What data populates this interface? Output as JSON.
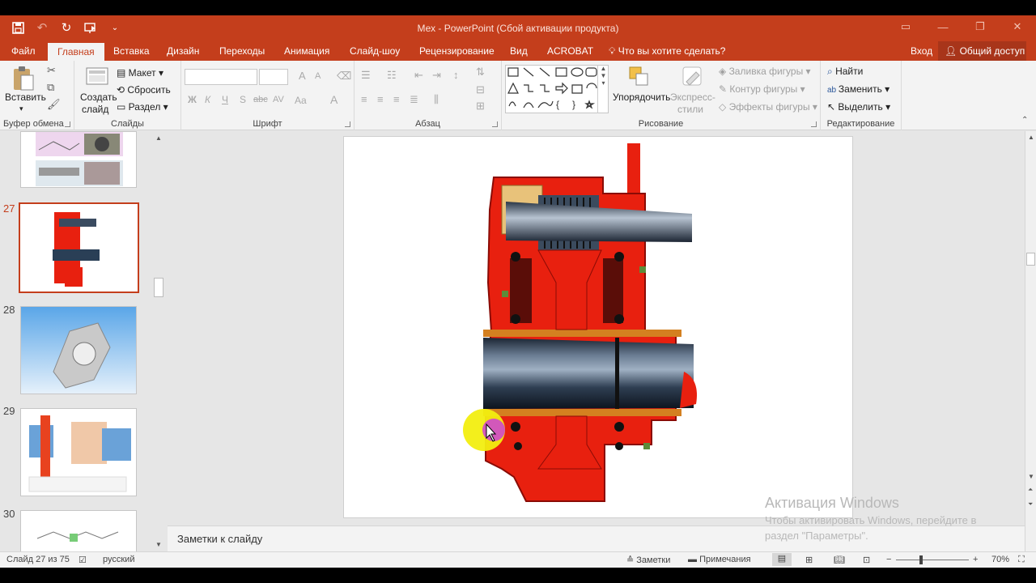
{
  "window": {
    "title": "Мех - PowerPoint (Сбой активации продукта)"
  },
  "tabs": [
    {
      "label": "Файл",
      "active": false
    },
    {
      "label": "Главная",
      "active": true
    },
    {
      "label": "Вставка",
      "active": false
    },
    {
      "label": "Дизайн",
      "active": false
    },
    {
      "label": "Переходы",
      "active": false
    },
    {
      "label": "Анимация",
      "active": false
    },
    {
      "label": "Слайд-шоу",
      "active": false
    },
    {
      "label": "Рецензирование",
      "active": false
    },
    {
      "label": "Вид",
      "active": false
    },
    {
      "label": "ACROBAT",
      "active": false
    }
  ],
  "tell_me": "Что вы хотите сделать?",
  "sign_in": "Вход",
  "share": "Общий доступ",
  "ribbon": {
    "clipboard": {
      "label": "Буфер обмена",
      "paste": "Вставить"
    },
    "slides": {
      "label": "Слайды",
      "new_slide_1": "Создать",
      "new_slide_2": "слайд",
      "layout": "Макет",
      "reset": "Сбросить",
      "section": "Раздел"
    },
    "font": {
      "label": "Шрифт",
      "bold": "Ж",
      "italic": "К",
      "underline": "Ч",
      "shadow": "S",
      "strike": "abc",
      "spacing": "AV",
      "case": "Aa",
      "color": "A",
      "grow": "A",
      "shrink": "A"
    },
    "paragraph": {
      "label": "Абзац"
    },
    "drawing": {
      "label": "Рисование",
      "arrange": "Упорядочить",
      "quick_styles_1": "Экспресс-",
      "quick_styles_2": "стили",
      "fill": "Заливка фигуры",
      "outline": "Контур фигуры",
      "effects": "Эффекты фигуры"
    },
    "editing": {
      "label": "Редактирование",
      "find": "Найти",
      "replace": "Заменить",
      "select": "Выделить"
    }
  },
  "thumbnails": [
    {
      "number": "",
      "selected": false
    },
    {
      "number": "27",
      "selected": true
    },
    {
      "number": "28",
      "selected": false
    },
    {
      "number": "29",
      "selected": false
    },
    {
      "number": "30",
      "selected": false
    }
  ],
  "notes_placeholder": "Заметки к слайду",
  "watermark": {
    "line1": "Активация Windows",
    "line2": "Чтобы активировать Windows, перейдите в",
    "line3": "раздел \"Параметры\"."
  },
  "status": {
    "slide": "Слайд 27 из 75",
    "language": "русский",
    "notes": "Заметки",
    "comments": "Примечания",
    "zoom": "70%"
  },
  "colors": {
    "accent": "#c43e1c",
    "part_red": "#e8200f",
    "shaft": "#2a3f56"
  }
}
